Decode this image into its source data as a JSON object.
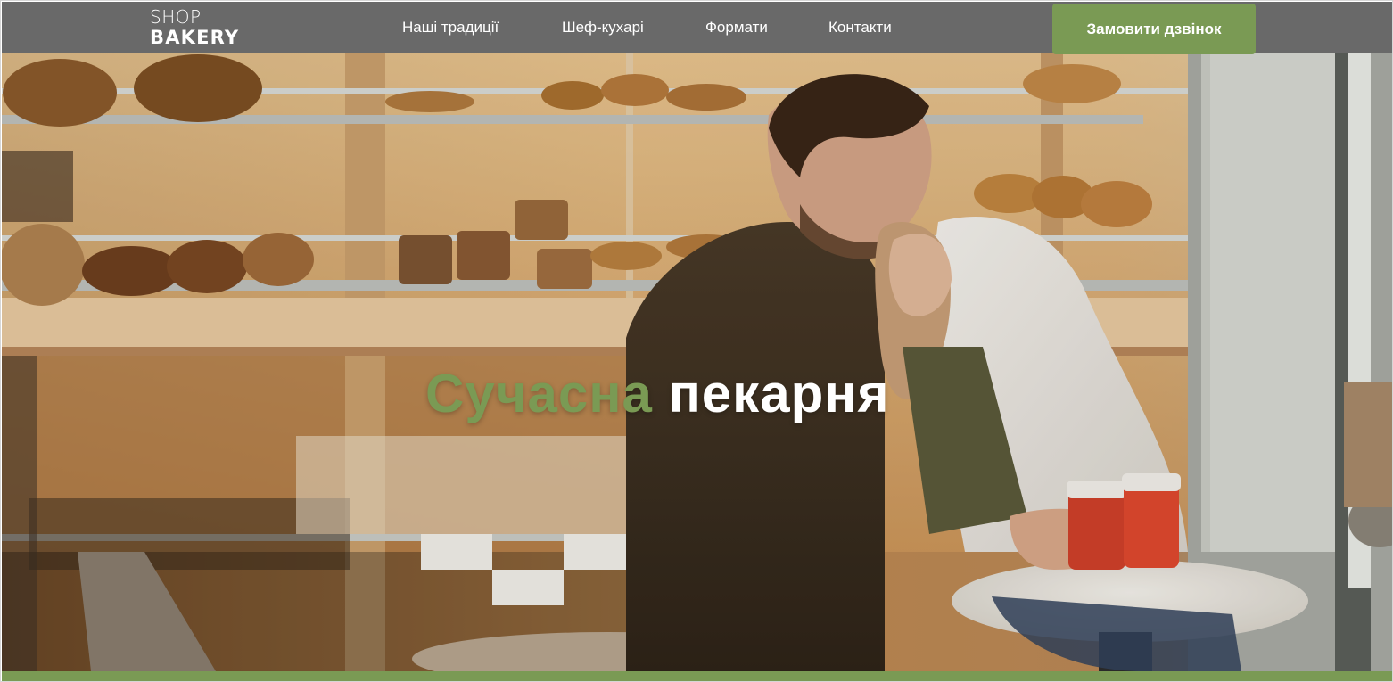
{
  "header": {
    "logo_top": "SHOP",
    "logo_bottom": "BAKERY",
    "nav": [
      {
        "label": "Наші традиції"
      },
      {
        "label": "Шеф-кухарі"
      },
      {
        "label": "Формати"
      },
      {
        "label": "Контакти"
      }
    ],
    "cta_label": "Замовити дзвінок"
  },
  "hero": {
    "title_accent": "Сучасна",
    "title_rest": "пекарня"
  },
  "colors": {
    "header_bg": "#696969",
    "accent": "#7a9a54",
    "text_light": "#ffffff"
  }
}
